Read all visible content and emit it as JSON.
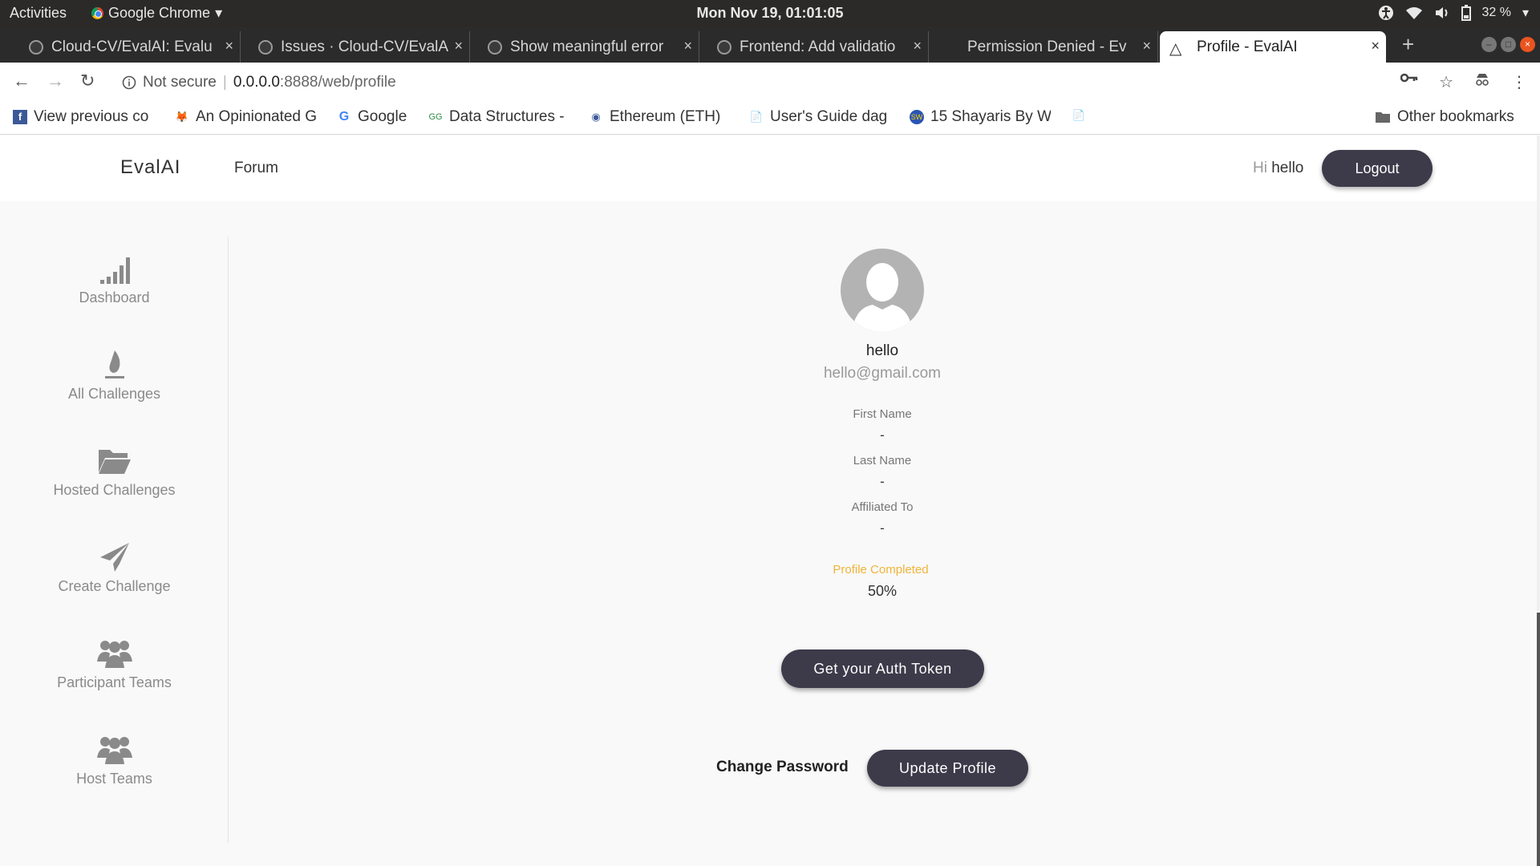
{
  "os_bar": {
    "activities": "Activities",
    "app_name": "Google Chrome",
    "app_caret": "▾",
    "clock": "Mon Nov 19, 01:01:05",
    "battery": "32 %"
  },
  "tabs": [
    {
      "label": "Cloud-CV/EvalAI: Evalu"
    },
    {
      "label": "Issues · Cloud-CV/EvalA"
    },
    {
      "label": "Show meaningful error"
    },
    {
      "label": "Frontend: Add validatio"
    },
    {
      "label": "Permission Denied - Ev"
    },
    {
      "label": "Profile - EvalAI"
    }
  ],
  "tab_close": "×",
  "address": {
    "security": "Not secure",
    "host": "0.0.0.0",
    "path": ":8888/web/profile"
  },
  "bookmarks": [
    {
      "label": "View previous co",
      "icon": "f"
    },
    {
      "label": "An Opinionated G",
      "icon": "🦊"
    },
    {
      "label": "Google",
      "icon": "G"
    },
    {
      "label": "Data Structures -",
      "icon": "GG"
    },
    {
      "label": "Ethereum (ETH) ",
      "icon": "◉"
    },
    {
      "label": "User's Guide dag",
      "icon": "📄"
    },
    {
      "label": "15 Shayaris By W",
      "icon": "SW"
    }
  ],
  "other_bookmarks": "Other bookmarks",
  "navbar": {
    "logo": "EvalAI",
    "forum": "Forum",
    "hi": "Hi",
    "username": "hello",
    "logout": "Logout"
  },
  "sidebar": {
    "items": [
      {
        "label": "Dashboard",
        "icon": "signal-bars-icon"
      },
      {
        "label": "All Challenges",
        "icon": "flame-icon"
      },
      {
        "label": "Hosted Challenges",
        "icon": "folder-open-icon"
      },
      {
        "label": "Create Challenge",
        "icon": "paper-plane-icon"
      },
      {
        "label": "Participant Teams",
        "icon": "users-icon"
      },
      {
        "label": "Host Teams",
        "icon": "users-icon"
      }
    ]
  },
  "profile": {
    "name": "hello",
    "email": "hello@gmail.com",
    "fields": [
      {
        "label": "First Name",
        "value": "-"
      },
      {
        "label": "Last Name",
        "value": "-"
      },
      {
        "label": "Affiliated To",
        "value": "-"
      }
    ],
    "completed_label": "Profile Completed",
    "completed_value": "50%",
    "auth_token_button": "Get your Auth Token",
    "change_password": "Change Password",
    "update_profile": "Update Profile"
  },
  "colors": {
    "button_dark": "#3d3b4a",
    "accent_yellow": "#f0b43a"
  }
}
